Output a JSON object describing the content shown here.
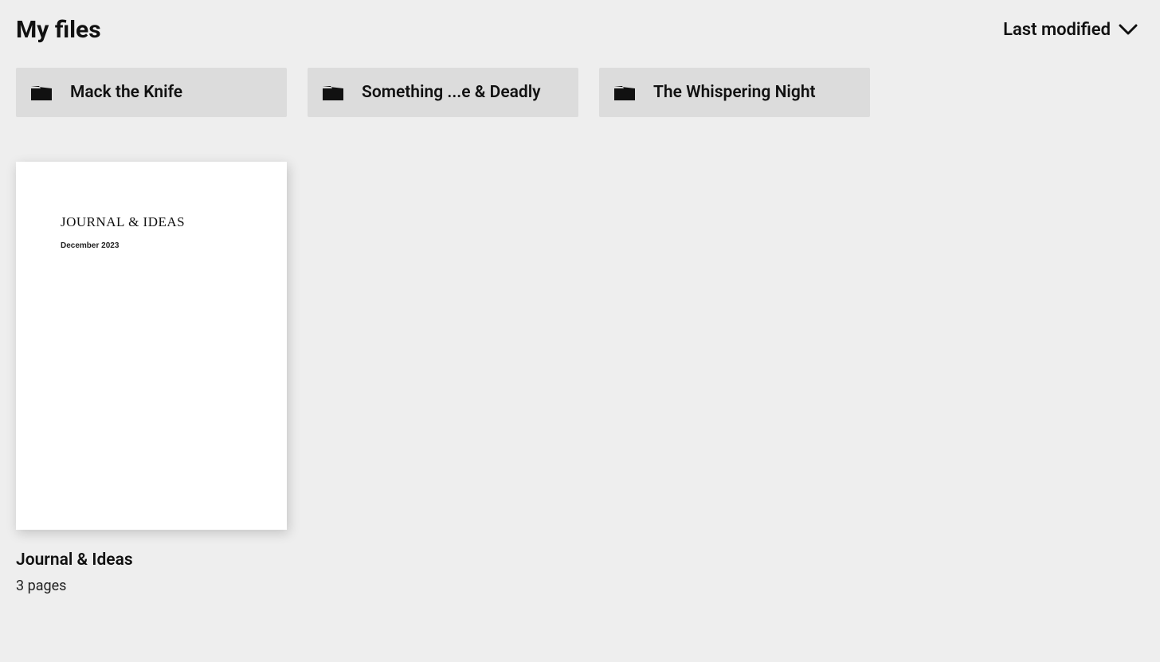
{
  "header": {
    "title": "My files",
    "sort_label": "Last modified"
  },
  "folders": [
    {
      "name": "Mack the Knife"
    },
    {
      "name": "Something ...e & Deadly"
    },
    {
      "name": "The Whispering Night"
    }
  ],
  "files": [
    {
      "title": "Journal & Ideas",
      "meta": "3 pages",
      "thumb": {
        "title": "JOURNAL & IDEAS",
        "subtitle": "December 2023"
      }
    }
  ]
}
